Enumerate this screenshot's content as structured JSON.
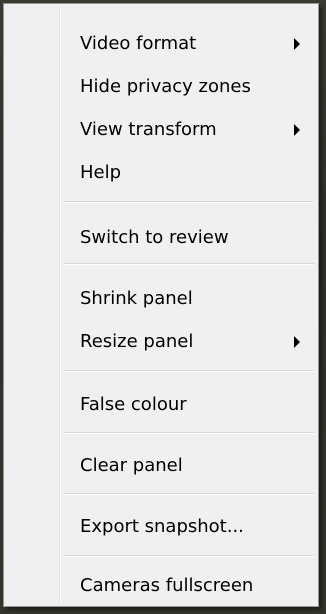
{
  "menu": {
    "items": [
      {
        "label": "Video format",
        "submenu": true
      },
      {
        "label": "Hide privacy zones",
        "submenu": false
      },
      {
        "label": "View transform",
        "submenu": true
      },
      {
        "label": "Help",
        "submenu": false
      },
      {
        "label": "Switch to review",
        "submenu": false
      },
      {
        "label": "Shrink panel",
        "submenu": false
      },
      {
        "label": "Resize panel",
        "submenu": true
      },
      {
        "label": "False colour",
        "submenu": false
      },
      {
        "label": "Clear panel",
        "submenu": false
      },
      {
        "label": "Export snapshot...",
        "submenu": false
      },
      {
        "label": "Cameras fullscreen",
        "submenu": false
      }
    ],
    "colors": {
      "background": "#f0f0f0",
      "border": "#979797",
      "text": "#000000",
      "separator": "#d7d7d7"
    }
  }
}
